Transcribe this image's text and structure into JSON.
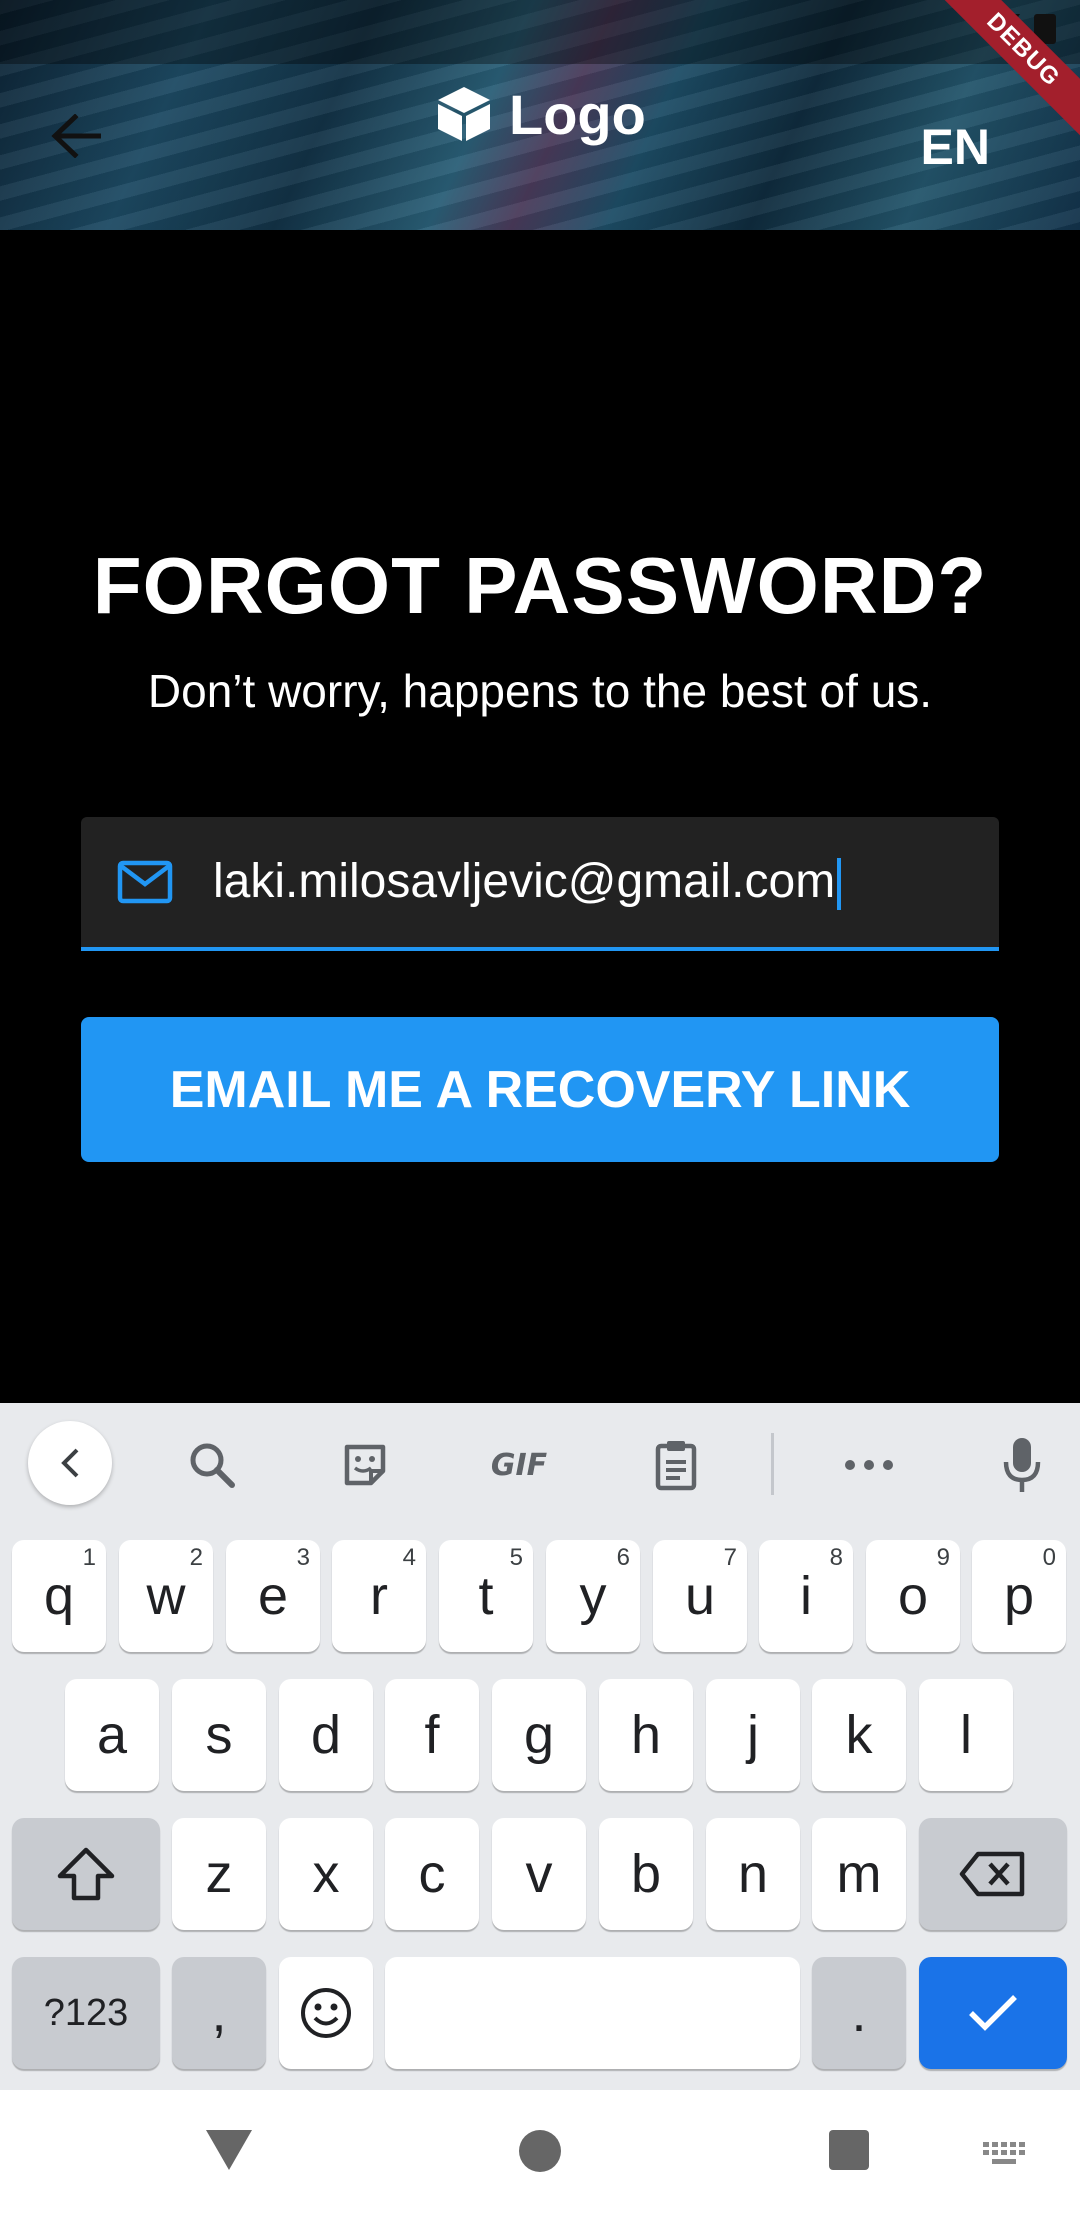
{
  "header": {
    "logo_text": "Logo",
    "language": "EN",
    "debug_banner": "DEBUG"
  },
  "main": {
    "title": "FORGOT PASSWORD?",
    "subtitle": "Don’t worry, happens to the best of us.",
    "email_value": "laki.milosavljevic@gmail.com",
    "recovery_button": "EMAIL ME A RECOVERY LINK"
  },
  "keyboard": {
    "toolbar": {
      "gif_label": "GIF"
    },
    "row1": [
      {
        "key": "q",
        "hint": "1"
      },
      {
        "key": "w",
        "hint": "2"
      },
      {
        "key": "e",
        "hint": "3"
      },
      {
        "key": "r",
        "hint": "4"
      },
      {
        "key": "t",
        "hint": "5"
      },
      {
        "key": "y",
        "hint": "6"
      },
      {
        "key": "u",
        "hint": "7"
      },
      {
        "key": "i",
        "hint": "8"
      },
      {
        "key": "o",
        "hint": "9"
      },
      {
        "key": "p",
        "hint": "0"
      }
    ],
    "row2": [
      "a",
      "s",
      "d",
      "f",
      "g",
      "h",
      "j",
      "k",
      "l"
    ],
    "row3": [
      "z",
      "x",
      "c",
      "v",
      "b",
      "n",
      "m"
    ],
    "symbols_key": "?123",
    "comma_key": ",",
    "period_key": "."
  },
  "colors": {
    "accent": "#2196f3",
    "keyboard_action": "#1a73e8",
    "background": "#000000"
  }
}
